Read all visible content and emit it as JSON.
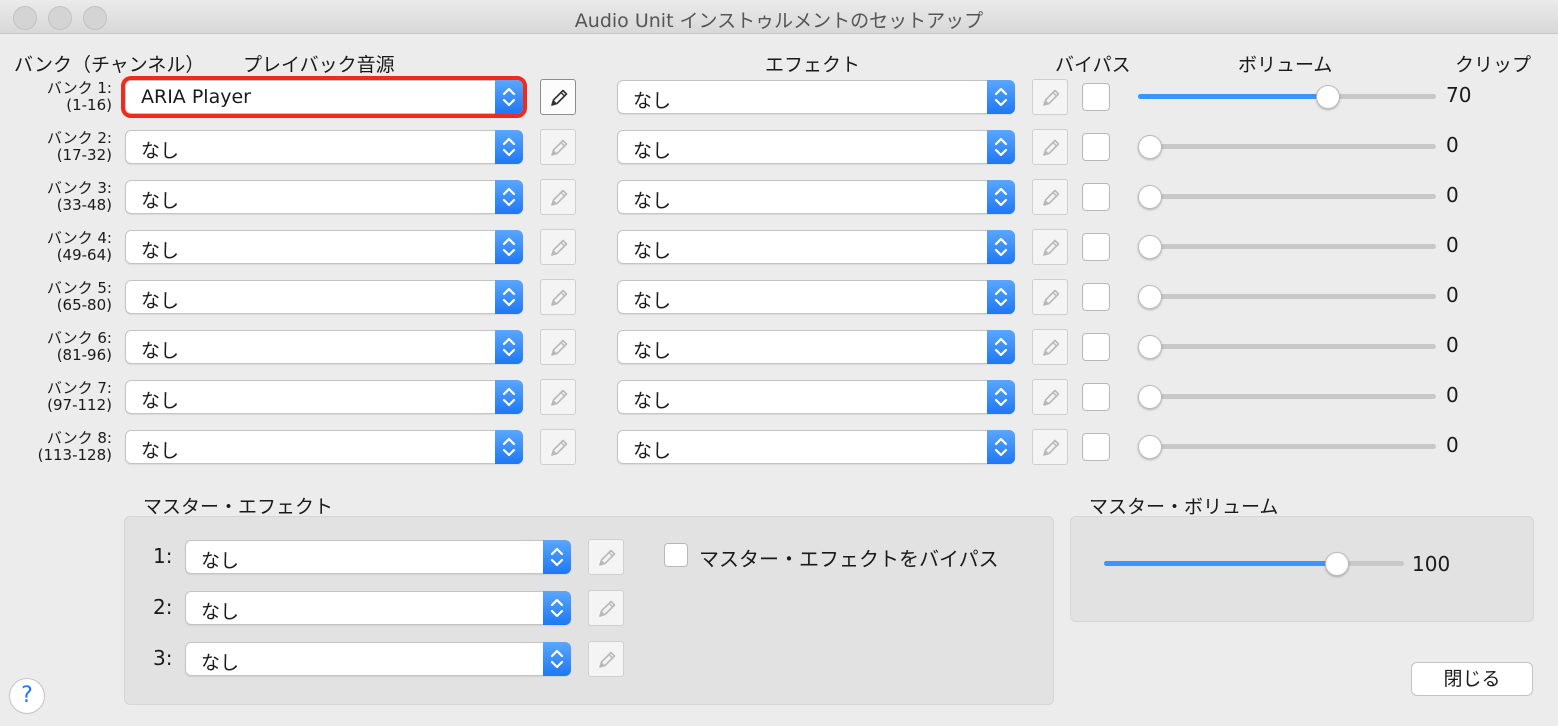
{
  "window": {
    "title": "Audio Unit インストゥルメントのセットアップ"
  },
  "headers": {
    "bank": "バンク（チャンネル）",
    "playback": "プレイバック音源",
    "effect": "エフェクト",
    "bypass": "バイパス",
    "volume": "ボリューム",
    "clip": "クリップ"
  },
  "banks": [
    {
      "name": "バンク 1:",
      "range": "(1-16)",
      "source": "ARIA Player",
      "effect": "なし",
      "volume": 70,
      "volume_fraction": 0.65,
      "highlighted": true,
      "source_edit_enabled": true
    },
    {
      "name": "バンク 2:",
      "range": "(17-32)",
      "source": "なし",
      "effect": "なし",
      "volume": 0,
      "volume_fraction": 0
    },
    {
      "name": "バンク 3:",
      "range": "(33-48)",
      "source": "なし",
      "effect": "なし",
      "volume": 0,
      "volume_fraction": 0
    },
    {
      "name": "バンク 4:",
      "range": "(49-64)",
      "source": "なし",
      "effect": "なし",
      "volume": 0,
      "volume_fraction": 0
    },
    {
      "name": "バンク 5:",
      "range": "(65-80)",
      "source": "なし",
      "effect": "なし",
      "volume": 0,
      "volume_fraction": 0
    },
    {
      "name": "バンク 6:",
      "range": "(81-96)",
      "source": "なし",
      "effect": "なし",
      "volume": 0,
      "volume_fraction": 0
    },
    {
      "name": "バンク 7:",
      "range": "(97-112)",
      "source": "なし",
      "effect": "なし",
      "volume": 0,
      "volume_fraction": 0
    },
    {
      "name": "バンク 8:",
      "range": "(113-128)",
      "source": "なし",
      "effect": "なし",
      "volume": 0,
      "volume_fraction": 0
    }
  ],
  "master_effect": {
    "title": "マスター・エフェクト",
    "slots": [
      {
        "num": "1:",
        "value": "なし"
      },
      {
        "num": "2:",
        "value": "なし"
      },
      {
        "num": "3:",
        "value": "なし"
      }
    ],
    "bypass_label": "マスター・エフェクトをバイパス"
  },
  "master_volume": {
    "title": "マスター・ボリューム",
    "value": 100,
    "fraction": 0.8
  },
  "buttons": {
    "close": "閉じる",
    "help": "?"
  },
  "icons": {
    "stepper": "up-down-chevron-icon",
    "edit": "pencil-icon"
  },
  "colors": {
    "accent": "#1f78f3",
    "highlight": "#f02a1d"
  }
}
